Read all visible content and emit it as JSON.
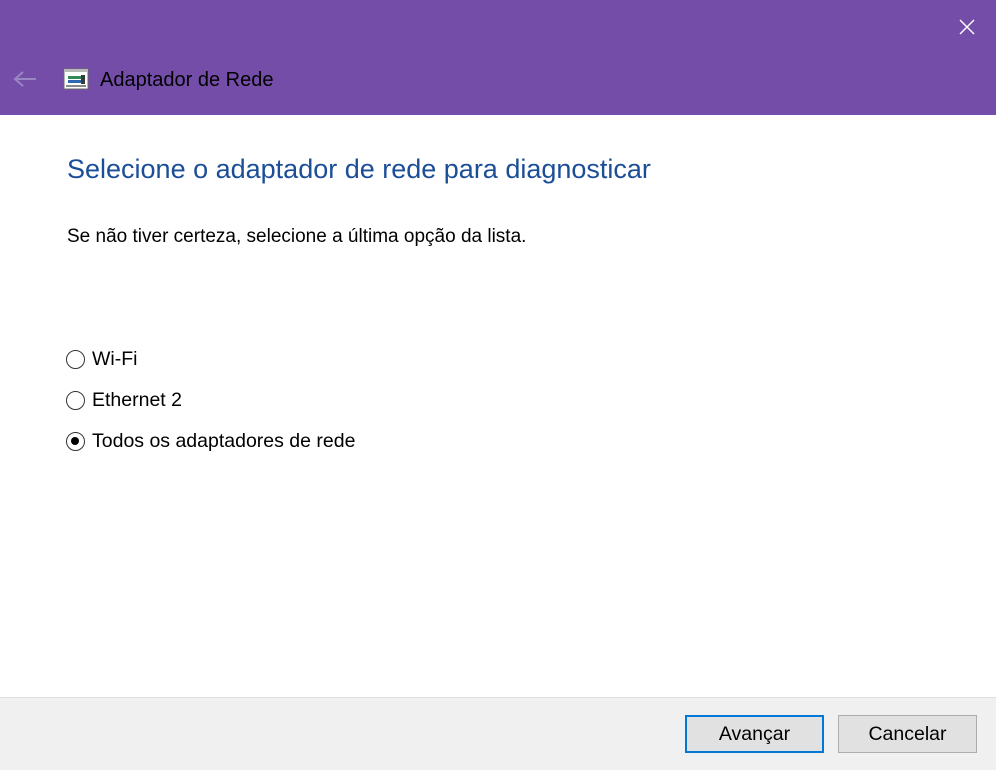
{
  "window": {
    "title": "Adaptador de Rede",
    "accent_color": "#744DA9",
    "icons": {
      "back": "arrow-left-icon",
      "close": "close-icon",
      "app": "network-adapter-icon"
    }
  },
  "content": {
    "title": "Selecione o adaptador de rede para diagnosticar",
    "title_color": "#1B4E97",
    "instruction": "Se não tiver certeza, selecione a última opção da lista."
  },
  "options": [
    {
      "label": "Wi-Fi",
      "checked": false
    },
    {
      "label": "Ethernet 2",
      "checked": false
    },
    {
      "label": "Todos os adaptadores de rede",
      "checked": true
    }
  ],
  "footer": {
    "next_label": "Avançar",
    "cancel_label": "Cancelar"
  }
}
